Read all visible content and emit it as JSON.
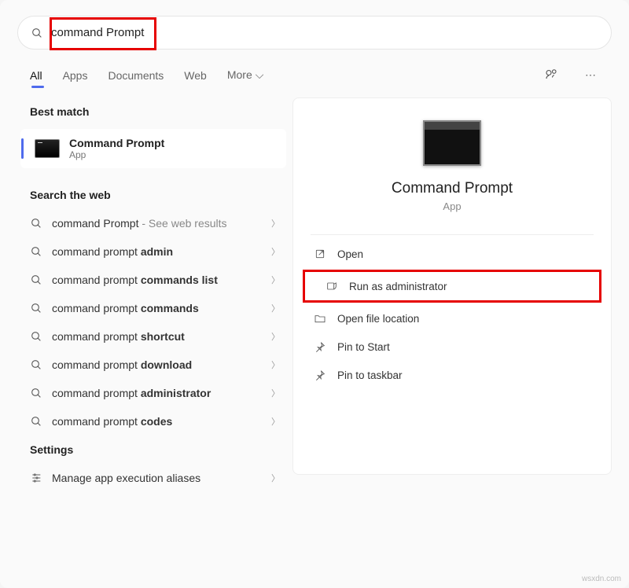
{
  "search": {
    "value": "command Prompt"
  },
  "nav": {
    "items": [
      "All",
      "Apps",
      "Documents",
      "Web",
      "More"
    ],
    "active_index": 0
  },
  "sections": {
    "best_match": "Best match",
    "search_web": "Search the web",
    "settings": "Settings"
  },
  "best_match": {
    "title": "Command Prompt",
    "subtitle": "App"
  },
  "web_items": [
    {
      "prefix": "command Prompt",
      "bold": "",
      "hint": " - See web results"
    },
    {
      "prefix": "command prompt ",
      "bold": "admin",
      "hint": ""
    },
    {
      "prefix": "command prompt ",
      "bold": "commands list",
      "hint": ""
    },
    {
      "prefix": "command prompt ",
      "bold": "commands",
      "hint": ""
    },
    {
      "prefix": "command prompt ",
      "bold": "shortcut",
      "hint": ""
    },
    {
      "prefix": "command prompt ",
      "bold": "download",
      "hint": ""
    },
    {
      "prefix": "command prompt ",
      "bold": "administrator",
      "hint": ""
    },
    {
      "prefix": "command prompt ",
      "bold": "codes",
      "hint": ""
    }
  ],
  "settings_items": [
    {
      "label": "Manage app execution aliases"
    }
  ],
  "detail": {
    "title": "Command Prompt",
    "subtitle": "App",
    "actions": [
      {
        "icon": "open",
        "label": "Open"
      },
      {
        "icon": "admin",
        "label": "Run as administrator",
        "highlight": true
      },
      {
        "icon": "folder",
        "label": "Open file location"
      },
      {
        "icon": "pin",
        "label": "Pin to Start"
      },
      {
        "icon": "pin",
        "label": "Pin to taskbar"
      }
    ]
  },
  "watermark": "wsxdn.com"
}
